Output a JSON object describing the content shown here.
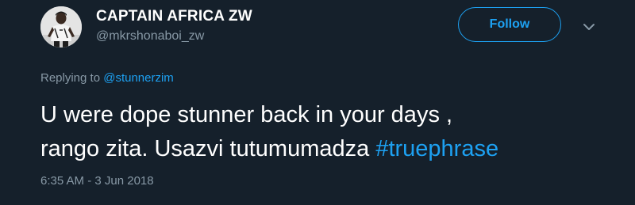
{
  "author": {
    "display_name": "CAPTAIN AFRICA ZW",
    "handle": "@mkrshonaboi_zw",
    "avatar_icon": "profile-photo"
  },
  "actions": {
    "follow_label": "Follow",
    "menu_icon": "chevron-down-icon"
  },
  "reply": {
    "prefix": "Replying to ",
    "to_handle": "@stunnerzim"
  },
  "tweet": {
    "line1": "U were dope stunner back in your days ,",
    "line2": "rango zita. Usazvi tutumumadza ",
    "hashtag": "#truephrase"
  },
  "meta": {
    "timestamp": "6:35 AM - 3 Jun 2018"
  },
  "colors": {
    "background": "#15202b",
    "accent": "#1da1f2",
    "muted": "#8899a6",
    "text": "#ffffff"
  }
}
